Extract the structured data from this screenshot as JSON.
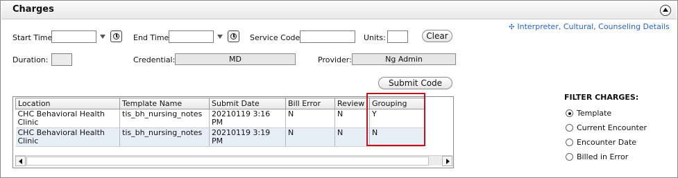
{
  "header": {
    "title": "Charges"
  },
  "link": {
    "text": "Interpreter, Cultural, Counseling Details"
  },
  "form": {
    "start_time_label": "Start Time:",
    "end_time_label": "End Time:",
    "service_code_label": "Service Code:",
    "units_label": "Units:",
    "clear_label": "Clear",
    "duration_label": "Duration:",
    "credential_label": "Credential:",
    "credential_value": "MD",
    "provider_label": "Provider:",
    "provider_value": "Ng Admin",
    "submit_label": "Submit Code"
  },
  "grid": {
    "columns": [
      "Location",
      "Template Name",
      "Submit Date",
      "Bill Error",
      "Review",
      "Grouping"
    ],
    "rows": [
      {
        "location": "CHC Behavioral Health Clinic",
        "template": "tis_bh_nursing_notes",
        "submit_date": "20210119 3:16 PM",
        "bill_error": "N",
        "review": "N",
        "grouping": "Y"
      },
      {
        "location": "CHC Behavioral Health Clinic",
        "template": "tis_bh_nursing_notes",
        "submit_date": "20210119 3:19 PM",
        "bill_error": "N",
        "review": "N",
        "grouping": "N"
      }
    ]
  },
  "filter": {
    "title": "FILTER CHARGES:",
    "options": [
      "Template",
      "Current Encounter",
      "Encounter Date",
      "Billed in Error"
    ],
    "selected": "Template"
  },
  "colors": {
    "link": "#2a62c4",
    "highlight": "#c0141c"
  }
}
